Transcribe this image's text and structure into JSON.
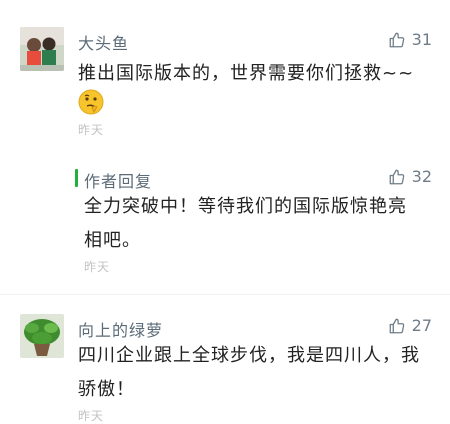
{
  "comments": [
    {
      "username": "大头鱼",
      "likes": "31",
      "text": "推出国际版本的，世界需要你们拯救~~",
      "emoji": "thinking-emoji",
      "time": "昨天"
    },
    {
      "username": "向上的绿萝",
      "likes": "27",
      "text": "四川企业跟上全球步伐，我是四川人，我骄傲！",
      "time": "昨天"
    }
  ],
  "author_reply": {
    "label": "作者回复",
    "likes": "32",
    "text": "全力突破中！等待我们的国际版惊艳亮相吧。",
    "time": "昨天"
  },
  "colors": {
    "accent_bar": "#20b23c",
    "username": "#5b6b78",
    "timestamp": "#c3c3c3"
  }
}
